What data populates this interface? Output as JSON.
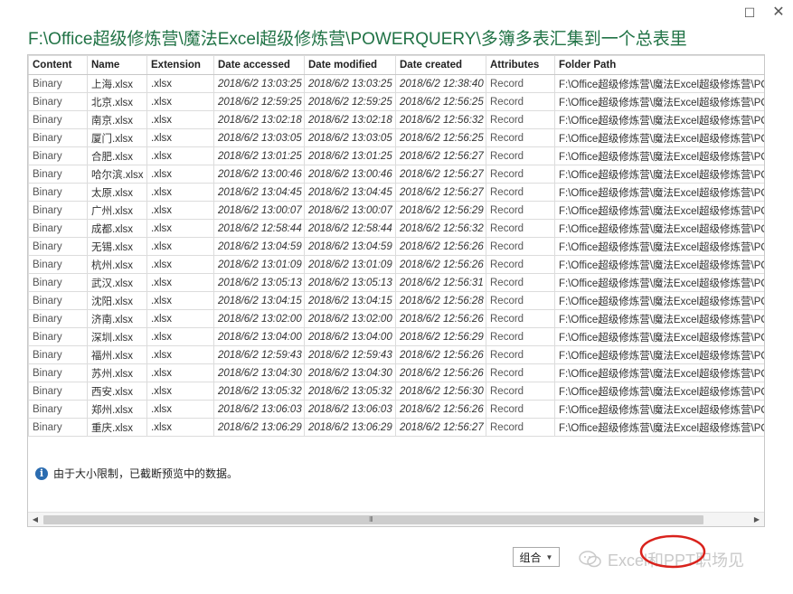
{
  "window": {
    "maximize_glyph": "☐",
    "close_glyph": "✕"
  },
  "path_title": "F:\\Office超级修炼营\\魔法Excel超级修炼营\\POWERQUERY\\多簿多表汇集到一个总表里",
  "table": {
    "columns": [
      "Content",
      "Name",
      "Extension",
      "Date accessed",
      "Date modified",
      "Date created",
      "Attributes",
      "Folder Path"
    ],
    "rows": [
      [
        "Binary",
        "上海.xlsx",
        ".xlsx",
        "2018/6/2 13:03:25",
        "2018/6/2 13:03:25",
        "2018/6/2 12:38:40",
        "Record",
        "F:\\Office超级修炼营\\魔法Excel超级修炼营\\PO"
      ],
      [
        "Binary",
        "北京.xlsx",
        ".xlsx",
        "2018/6/2 12:59:25",
        "2018/6/2 12:59:25",
        "2018/6/2 12:56:25",
        "Record",
        "F:\\Office超级修炼营\\魔法Excel超级修炼营\\PO"
      ],
      [
        "Binary",
        "南京.xlsx",
        ".xlsx",
        "2018/6/2 13:02:18",
        "2018/6/2 13:02:18",
        "2018/6/2 12:56:32",
        "Record",
        "F:\\Office超级修炼营\\魔法Excel超级修炼营\\PO"
      ],
      [
        "Binary",
        "厦门.xlsx",
        ".xlsx",
        "2018/6/2 13:03:05",
        "2018/6/2 13:03:05",
        "2018/6/2 12:56:25",
        "Record",
        "F:\\Office超级修炼营\\魔法Excel超级修炼营\\PO"
      ],
      [
        "Binary",
        "合肥.xlsx",
        ".xlsx",
        "2018/6/2 13:01:25",
        "2018/6/2 13:01:25",
        "2018/6/2 12:56:27",
        "Record",
        "F:\\Office超级修炼营\\魔法Excel超级修炼营\\PO"
      ],
      [
        "Binary",
        "哈尔滨.xlsx",
        ".xlsx",
        "2018/6/2 13:00:46",
        "2018/6/2 13:00:46",
        "2018/6/2 12:56:27",
        "Record",
        "F:\\Office超级修炼营\\魔法Excel超级修炼营\\PO"
      ],
      [
        "Binary",
        "太原.xlsx",
        ".xlsx",
        "2018/6/2 13:04:45",
        "2018/6/2 13:04:45",
        "2018/6/2 12:56:27",
        "Record",
        "F:\\Office超级修炼营\\魔法Excel超级修炼营\\PO"
      ],
      [
        "Binary",
        "广州.xlsx",
        ".xlsx",
        "2018/6/2 13:00:07",
        "2018/6/2 13:00:07",
        "2018/6/2 12:56:29",
        "Record",
        "F:\\Office超级修炼营\\魔法Excel超级修炼营\\PO"
      ],
      [
        "Binary",
        "成都.xlsx",
        ".xlsx",
        "2018/6/2 12:58:44",
        "2018/6/2 12:58:44",
        "2018/6/2 12:56:32",
        "Record",
        "F:\\Office超级修炼营\\魔法Excel超级修炼营\\PO"
      ],
      [
        "Binary",
        "无锡.xlsx",
        ".xlsx",
        "2018/6/2 13:04:59",
        "2018/6/2 13:04:59",
        "2018/6/2 12:56:26",
        "Record",
        "F:\\Office超级修炼营\\魔法Excel超级修炼营\\PO"
      ],
      [
        "Binary",
        "杭州.xlsx",
        ".xlsx",
        "2018/6/2 13:01:09",
        "2018/6/2 13:01:09",
        "2018/6/2 12:56:26",
        "Record",
        "F:\\Office超级修炼营\\魔法Excel超级修炼营\\PO"
      ],
      [
        "Binary",
        "武汉.xlsx",
        ".xlsx",
        "2018/6/2 13:05:13",
        "2018/6/2 13:05:13",
        "2018/6/2 12:56:31",
        "Record",
        "F:\\Office超级修炼营\\魔法Excel超级修炼营\\PO"
      ],
      [
        "Binary",
        "沈阳.xlsx",
        ".xlsx",
        "2018/6/2 13:04:15",
        "2018/6/2 13:04:15",
        "2018/6/2 12:56:28",
        "Record",
        "F:\\Office超级修炼营\\魔法Excel超级修炼营\\PO"
      ],
      [
        "Binary",
        "济南.xlsx",
        ".xlsx",
        "2018/6/2 13:02:00",
        "2018/6/2 13:02:00",
        "2018/6/2 12:56:26",
        "Record",
        "F:\\Office超级修炼营\\魔法Excel超级修炼营\\PO"
      ],
      [
        "Binary",
        "深圳.xlsx",
        ".xlsx",
        "2018/6/2 13:04:00",
        "2018/6/2 13:04:00",
        "2018/6/2 12:56:29",
        "Record",
        "F:\\Office超级修炼营\\魔法Excel超级修炼营\\PO"
      ],
      [
        "Binary",
        "福州.xlsx",
        ".xlsx",
        "2018/6/2 12:59:43",
        "2018/6/2 12:59:43",
        "2018/6/2 12:56:26",
        "Record",
        "F:\\Office超级修炼营\\魔法Excel超级修炼营\\PO"
      ],
      [
        "Binary",
        "苏州.xlsx",
        ".xlsx",
        "2018/6/2 13:04:30",
        "2018/6/2 13:04:30",
        "2018/6/2 12:56:26",
        "Record",
        "F:\\Office超级修炼营\\魔法Excel超级修炼营\\PO"
      ],
      [
        "Binary",
        "西安.xlsx",
        ".xlsx",
        "2018/6/2 13:05:32",
        "2018/6/2 13:05:32",
        "2018/6/2 12:56:30",
        "Record",
        "F:\\Office超级修炼营\\魔法Excel超级修炼营\\PO"
      ],
      [
        "Binary",
        "郑州.xlsx",
        ".xlsx",
        "2018/6/2 13:06:03",
        "2018/6/2 13:06:03",
        "2018/6/2 12:56:26",
        "Record",
        "F:\\Office超级修炼营\\魔法Excel超级修炼营\\PO"
      ],
      [
        "Binary",
        "重庆.xlsx",
        ".xlsx",
        "2018/6/2 13:06:29",
        "2018/6/2 13:06:29",
        "2018/6/2 12:56:27",
        "Record",
        "F:\\Office超级修炼营\\魔法Excel超级修炼营\\PO"
      ]
    ]
  },
  "notice": {
    "icon": "info-icon",
    "text": "由于大小限制，已截断预览中的数据。"
  },
  "scrollbar": {
    "left_arrow": "◀",
    "right_arrow": "▶",
    "grip": "III"
  },
  "footer": {
    "combine_label": "组合",
    "caret": "▼"
  },
  "watermark": {
    "text": "Excel和PPT职场见"
  },
  "colors": {
    "title_green": "#217346",
    "annotation_red": "#d9221c",
    "info_blue": "#2b6cb0"
  }
}
